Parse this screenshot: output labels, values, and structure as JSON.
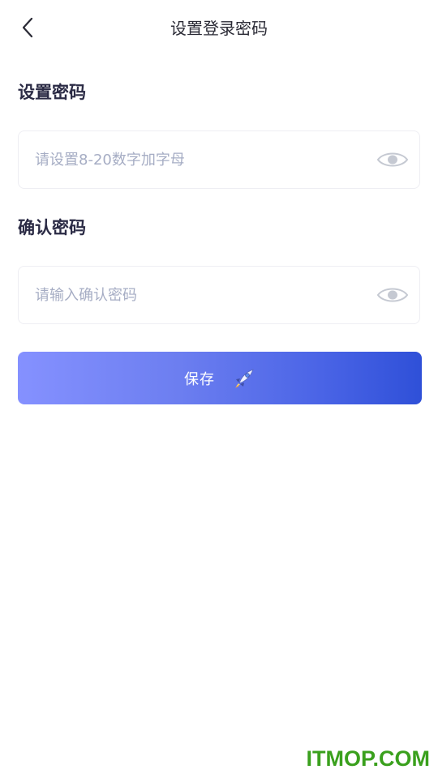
{
  "header": {
    "title": "设置登录密码",
    "back_icon": "chevron-left-icon"
  },
  "password_section": {
    "label": "设置密码",
    "placeholder": "请设置8-20数字加字母",
    "value": "",
    "toggle_icon": "eye-icon"
  },
  "confirm_section": {
    "label": "确认密码",
    "placeholder": "请输入确认密码",
    "value": "",
    "toggle_icon": "eye-icon"
  },
  "save_button": {
    "label": "保存",
    "icon": "rocket-icon"
  },
  "watermark": {
    "text": "ITMOP.COM"
  },
  "colors": {
    "button_gradient_start": "#8591ff",
    "button_gradient_end": "#2f50d8",
    "label_color": "#2b2b45",
    "placeholder_color": "#a6adc4",
    "watermark_color": "#3aa01d"
  }
}
